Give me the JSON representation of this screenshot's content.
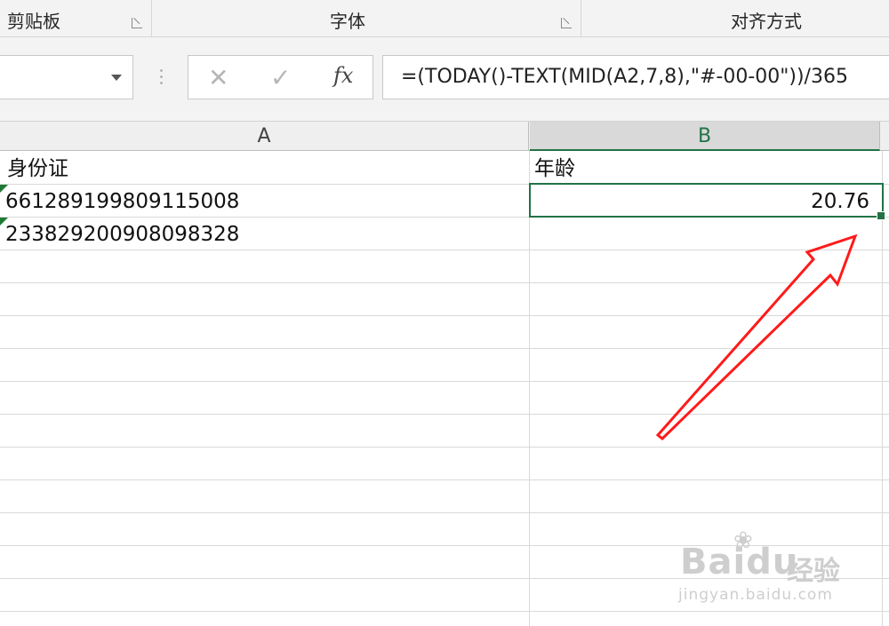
{
  "ribbon": {
    "groups": [
      {
        "label": "剪贴板"
      },
      {
        "label": "字体"
      },
      {
        "label": "对齐方式"
      }
    ]
  },
  "formula_bar": {
    "name_box_value": "",
    "cancel_icon": "✕",
    "enter_icon": "✓",
    "fx_label": "fx",
    "formula": "=(TODAY()-TEXT(MID(A2,7,8),\"#-00-00\"))/365"
  },
  "sheet": {
    "columns": [
      "A",
      "B"
    ],
    "selected_column": "B",
    "cells": {
      "A1": "身份证",
      "B1": "年龄",
      "A2": "661289199809115008",
      "B2": "20.76",
      "A3": "233829200908098328"
    },
    "active_cell": "B2"
  },
  "annotation": {
    "arrow_color": "#ff1a1a"
  },
  "watermark": {
    "logo": "Baidu",
    "suffix": "经验",
    "url": "jingyan.baidu.com"
  },
  "colors": {
    "excel_green": "#217346",
    "grid": "#d9d9d9",
    "ribbon_bg": "#f3f3f3"
  }
}
